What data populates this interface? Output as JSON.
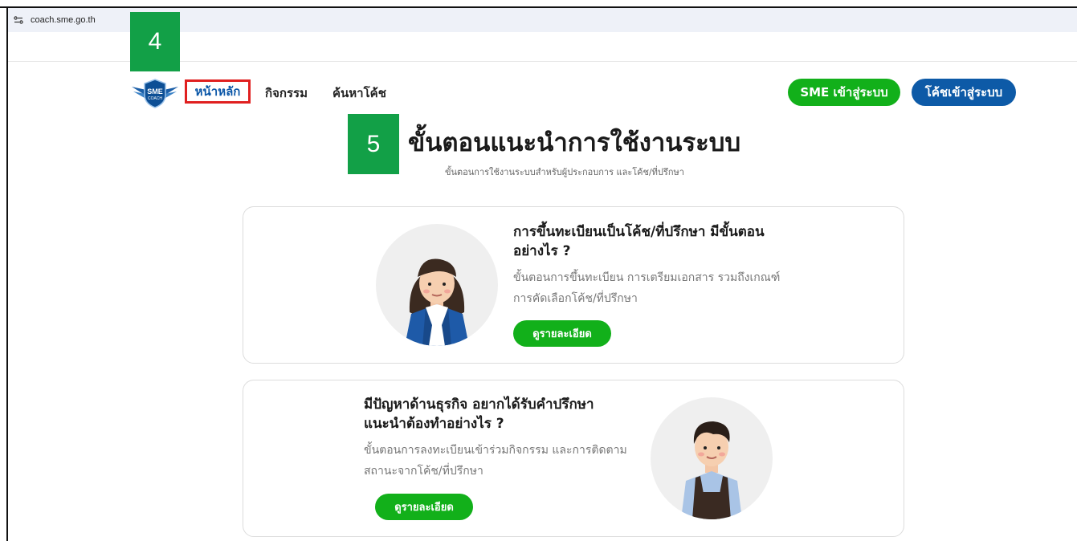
{
  "browser": {
    "url": "coach.sme.go.th",
    "site_info_icon": "site-settings-icon"
  },
  "annotations": {
    "step_4": "4",
    "step_5": "5"
  },
  "header": {
    "logo": {
      "text_top": "SME",
      "text_bottom": "COACH",
      "icon": "sme-coach-logo"
    },
    "nav": [
      {
        "label": "หน้าหลัก"
      },
      {
        "label": "กิจกรรม"
      },
      {
        "label": "ค้นหาโค้ช"
      }
    ],
    "sme_login_label": "SME เข้าสู่ระบบ",
    "coach_login_label": "โค้ชเข้าสู่ระบบ",
    "colors": {
      "green": "#12b01a",
      "blue": "#0d5aa7",
      "highlight": "#e02020",
      "badge": "#12a047"
    }
  },
  "main": {
    "title": "ขั้นตอนแนะนำการใช้งานระบบ",
    "subtitle": "ขั้นตอนการใช้งานระบบสำหรับผู้ประกอบการ และโค้ช/ที่ปรึกษา",
    "cards": [
      {
        "title": "การขึ้นทะเบียนเป็นโค้ช/ที่ปรึกษา มีขั้นตอนอย่างไร ?",
        "description": "ขั้นตอนการขึ้นทะเบียน การเตรียมเอกสาร รวมถึงเกณฑ์การคัดเลือกโค้ช/ที่ปรึกษา",
        "button_label": "ดูรายละเอียด",
        "image": "woman-coach-illustration"
      },
      {
        "title": "มีปัญหาด้านธุรกิจ อยากได้รับคำปรึกษา แนะนำต้องทำอย่างไร ?",
        "description": "ขั้นตอนการลงทะเบียนเข้าร่วมกิจกรรม และการติดตาม สถานะจากโค้ช/ที่ปรึกษา",
        "button_label": "ดูรายละเอียด",
        "image": "man-entrepreneur-illustration"
      }
    ]
  }
}
